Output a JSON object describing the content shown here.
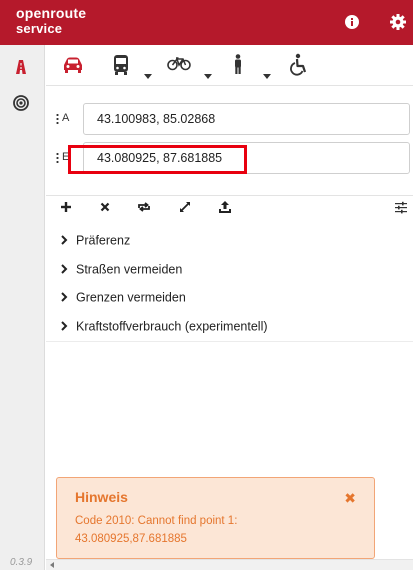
{
  "header": {
    "logo_line1": "openroute",
    "logo_line2": "service",
    "bg_color": "#b5192b",
    "buttons": [
      {
        "name": "info-icon"
      },
      {
        "name": "gear-icon"
      }
    ]
  },
  "sidebar": {
    "items": [
      {
        "name": "route-icon",
        "active": true
      },
      {
        "name": "isochrone-icon",
        "active": false
      }
    ],
    "version": "0.3.9"
  },
  "profiles": [
    {
      "name": "car-icon",
      "active": true,
      "has_dropdown": false
    },
    {
      "name": "bus-icon",
      "active": false,
      "has_dropdown": true
    },
    {
      "name": "bicycle-icon",
      "active": false,
      "has_dropdown": true
    },
    {
      "name": "pedestrian-icon",
      "active": false,
      "has_dropdown": true
    },
    {
      "name": "wheelchair-icon",
      "active": false,
      "has_dropdown": false
    }
  ],
  "waypoints": [
    {
      "letter": "A",
      "value": "43.100983, 85.02868"
    },
    {
      "letter": "E",
      "value": "43.080925, 87.681885"
    }
  ],
  "actions": [
    "add-icon",
    "remove-icon",
    "reverse-icon",
    "fit-icon",
    "upload-icon",
    "settings-sliders-icon"
  ],
  "options": [
    {
      "label": "Präferenz"
    },
    {
      "label": "Straßen vermeiden"
    },
    {
      "label": "Grenzen vermeiden"
    },
    {
      "label": "Kraftstoffverbrauch (experimentell)"
    }
  ],
  "notice": {
    "title": "Hinweis",
    "close_label": "✖",
    "message_line1": "Code 2010: Cannot find point 1:",
    "message_line2": "43.080925,87.681885",
    "color": "#e5762e"
  },
  "highlight_color": "#e8000f"
}
